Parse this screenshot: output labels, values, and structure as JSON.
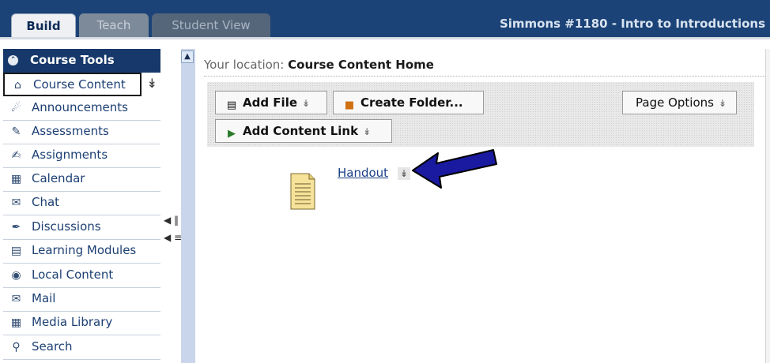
{
  "tabs": {
    "build": "Build",
    "teach": "Teach",
    "student_view": "Student View"
  },
  "course_title": "Simmons #1180 - Intro to Introductions",
  "sidebar": {
    "header": "Course Tools",
    "items": [
      {
        "label": "Course Content",
        "icon": "home-icon",
        "active": true
      },
      {
        "label": "Announcements",
        "icon": "megaphone-icon"
      },
      {
        "label": "Assessments",
        "icon": "assessment-icon"
      },
      {
        "label": "Assignments",
        "icon": "assignment-icon"
      },
      {
        "label": "Calendar",
        "icon": "calendar-icon"
      },
      {
        "label": "Chat",
        "icon": "chat-icon"
      },
      {
        "label": "Discussions",
        "icon": "discussion-icon"
      },
      {
        "label": "Learning Modules",
        "icon": "modules-icon"
      },
      {
        "label": "Local Content",
        "icon": "cd-icon"
      },
      {
        "label": "Mail",
        "icon": "mail-icon"
      },
      {
        "label": "Media Library",
        "icon": "media-icon"
      },
      {
        "label": "Search",
        "icon": "search-icon"
      }
    ]
  },
  "main": {
    "location_prefix": "Your location:",
    "location_value": "Course Content Home",
    "toolbar": {
      "add_file": "Add File",
      "create_folder": "Create Folder...",
      "page_options": "Page Options",
      "add_content_link": "Add Content Link"
    },
    "items": [
      {
        "label": "Handout",
        "icon": "document-icon"
      }
    ]
  },
  "colors": {
    "topbar": "#1b4377",
    "sidebar_header": "#16386a",
    "link": "#1a3f86",
    "arrow": "#1a1aa0"
  }
}
